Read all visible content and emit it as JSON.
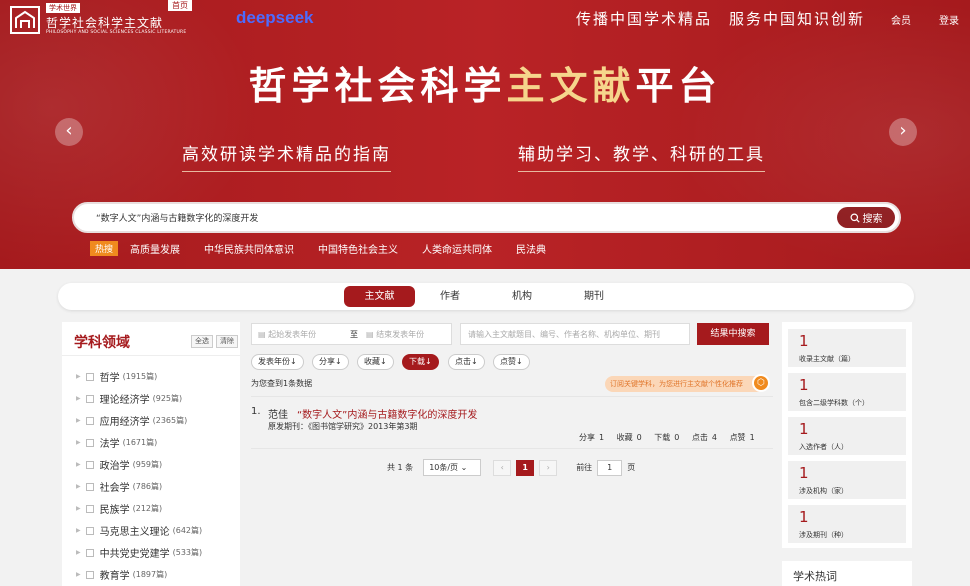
{
  "header": {
    "logo_tag": "学术世界",
    "logo_title": "哲学社会科学主文献",
    "logo_en": "PHILOSOPHY AND SOCIAL SCIENCES CLASSIC LITERATURE",
    "home": "首页",
    "deepseek": "deepseek",
    "slogan": "传播中国学术精品　服务中国知识创新",
    "member": "会员",
    "login": "登录"
  },
  "hero": {
    "title_a": "哲学社会科学",
    "title_b": "主文献",
    "title_c": "平台",
    "sub1": "高效研读学术精品的指南",
    "sub2": "辅助学习、教学、科研的工具",
    "search_value": "“数字人文”内涵与古籍数字化的深度开发",
    "search_btn": "搜索",
    "hot_label": "热搜",
    "hot_items": [
      "高质量发展",
      "中华民族共同体意识",
      "中国特色社会主义",
      "人类命运共同体",
      "民法典"
    ]
  },
  "tabs": [
    "主文献",
    "作者",
    "机构",
    "期刊"
  ],
  "left": {
    "title": "学科领域",
    "btn_all": "全选",
    "btn_clear": "清除",
    "subjects": [
      {
        "name": "哲学",
        "count": "(1915篇)"
      },
      {
        "name": "理论经济学",
        "count": "(925篇)"
      },
      {
        "name": "应用经济学",
        "count": "(2365篇)"
      },
      {
        "name": "法学",
        "count": "(1671篇)"
      },
      {
        "name": "政治学",
        "count": "(959篇)"
      },
      {
        "name": "社会学",
        "count": "(786篇)"
      },
      {
        "name": "民族学",
        "count": "(212篇)"
      },
      {
        "name": "马克思主义理论",
        "count": "(642篇)"
      },
      {
        "name": "中共党史党建学",
        "count": "(533篇)"
      },
      {
        "name": "教育学",
        "count": "(1897篇)"
      }
    ]
  },
  "filters": {
    "start_year": "起始发表年份",
    "to": "至",
    "end_year": "结束发表年份",
    "keyword_placeholder": "请输入主文献题目、编号、作者名称、机构单位、期刊",
    "in_search": "结果中搜索",
    "sorts": [
      "发表年份↓",
      "分享↓",
      "收藏↓",
      "下载↓",
      "点击↓",
      "点赞↓"
    ],
    "found": "为您查到1条数据",
    "notice": "订阅关键学科，为您进行主文献个性化推荐"
  },
  "result": {
    "num": "1.",
    "author": "范佳",
    "title": "“数字人文”内涵与古籍数字化的深度开发",
    "source": "原发期刊：《图书馆学研究》2013年第3期",
    "stats": [
      "分享",
      "1",
      "收藏",
      "0",
      "下载",
      "0",
      "点击",
      "4",
      "点赞",
      "1"
    ]
  },
  "pager": {
    "total": "共 1 条",
    "size": "10条/页",
    "prev": "‹",
    "page": "1",
    "next": "›",
    "goto": "前往",
    "goto_value": "1",
    "unit": "页"
  },
  "right": {
    "cards": [
      {
        "num": "1",
        "label": "收录主文献（篇）"
      },
      {
        "num": "1",
        "label": "包含二级学科数（个）"
      },
      {
        "num": "1",
        "label": "入选作者（人）"
      },
      {
        "num": "1",
        "label": "涉及机构（家）"
      },
      {
        "num": "1",
        "label": "涉及期刊（种）"
      }
    ],
    "hot_title": "学术热词"
  },
  "colors": {
    "brand": "#a51a1d",
    "accent": "#f08a1e",
    "deepseek": "#4d6bfe"
  }
}
